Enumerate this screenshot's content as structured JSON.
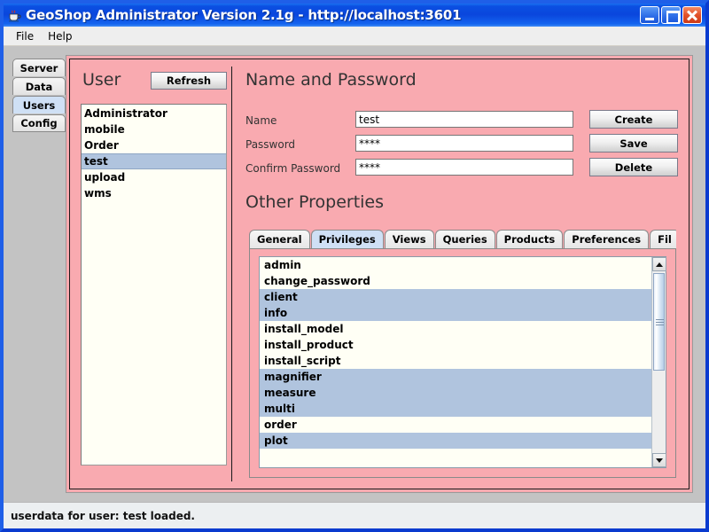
{
  "window": {
    "title": "GeoShop Administrator Version 2.1g - http://localhost:3601",
    "icon": "java-coffee-cup-icon",
    "buttons": {
      "minimize": "minimize-icon",
      "maximize": "maximize-icon",
      "close": "close-icon"
    }
  },
  "menubar": {
    "items": [
      {
        "label": "File"
      },
      {
        "label": "Help"
      }
    ]
  },
  "vertical_tabs": {
    "items": [
      {
        "label": "Server",
        "selected": false
      },
      {
        "label": "Data",
        "selected": false
      },
      {
        "label": "Users",
        "selected": true
      },
      {
        "label": "Config",
        "selected": false
      }
    ]
  },
  "user_panel": {
    "title": "User",
    "refresh_label": "Refresh",
    "users": [
      {
        "label": "Administrator",
        "selected": false
      },
      {
        "label": "mobile",
        "selected": false
      },
      {
        "label": "Order",
        "selected": false
      },
      {
        "label": "test",
        "selected": true
      },
      {
        "label": "upload",
        "selected": false
      },
      {
        "label": "wms",
        "selected": false
      }
    ]
  },
  "name_password": {
    "title": "Name and Password",
    "fields": [
      {
        "label": "Name",
        "value": "test",
        "placeholder": "",
        "button": "Create"
      },
      {
        "label": "Password",
        "value": "****",
        "placeholder": "",
        "button": "Save"
      },
      {
        "label": "Confirm Password",
        "value": "****",
        "placeholder": "",
        "button": "Delete"
      }
    ]
  },
  "other_properties": {
    "title": "Other Properties",
    "tabs": [
      {
        "label": "General",
        "selected": false
      },
      {
        "label": "Privileges",
        "selected": true
      },
      {
        "label": "Views",
        "selected": false
      },
      {
        "label": "Queries",
        "selected": false
      },
      {
        "label": "Products",
        "selected": false
      },
      {
        "label": "Preferences",
        "selected": false
      },
      {
        "label": "Fil",
        "selected": false
      }
    ],
    "tab_scroll": {
      "left_icon": "chevron-left-icon",
      "right_icon": "chevron-right-icon"
    },
    "privileges": [
      {
        "label": "admin",
        "selected": false
      },
      {
        "label": "change_password",
        "selected": false
      },
      {
        "label": "client",
        "selected": true
      },
      {
        "label": "info",
        "selected": true
      },
      {
        "label": "install_model",
        "selected": false
      },
      {
        "label": "install_product",
        "selected": false
      },
      {
        "label": "install_script",
        "selected": false
      },
      {
        "label": "magnifier",
        "selected": true
      },
      {
        "label": "measure",
        "selected": true
      },
      {
        "label": "multi",
        "selected": true
      },
      {
        "label": "order",
        "selected": false
      },
      {
        "label": "plot",
        "selected": true
      }
    ],
    "scrollbar": {
      "up_icon": "scroll-up-arrow-icon",
      "down_icon": "scroll-down-arrow-icon"
    }
  },
  "statusbar": {
    "message": "userdata for user: test loaded."
  },
  "colors": {
    "panel_pink": "#f9aab0",
    "selection_blue": "#b0c4de",
    "tab_selected": "#cfe0f5",
    "titlebar_blue": "#0b4fe2",
    "close_red": "#e2512a"
  }
}
